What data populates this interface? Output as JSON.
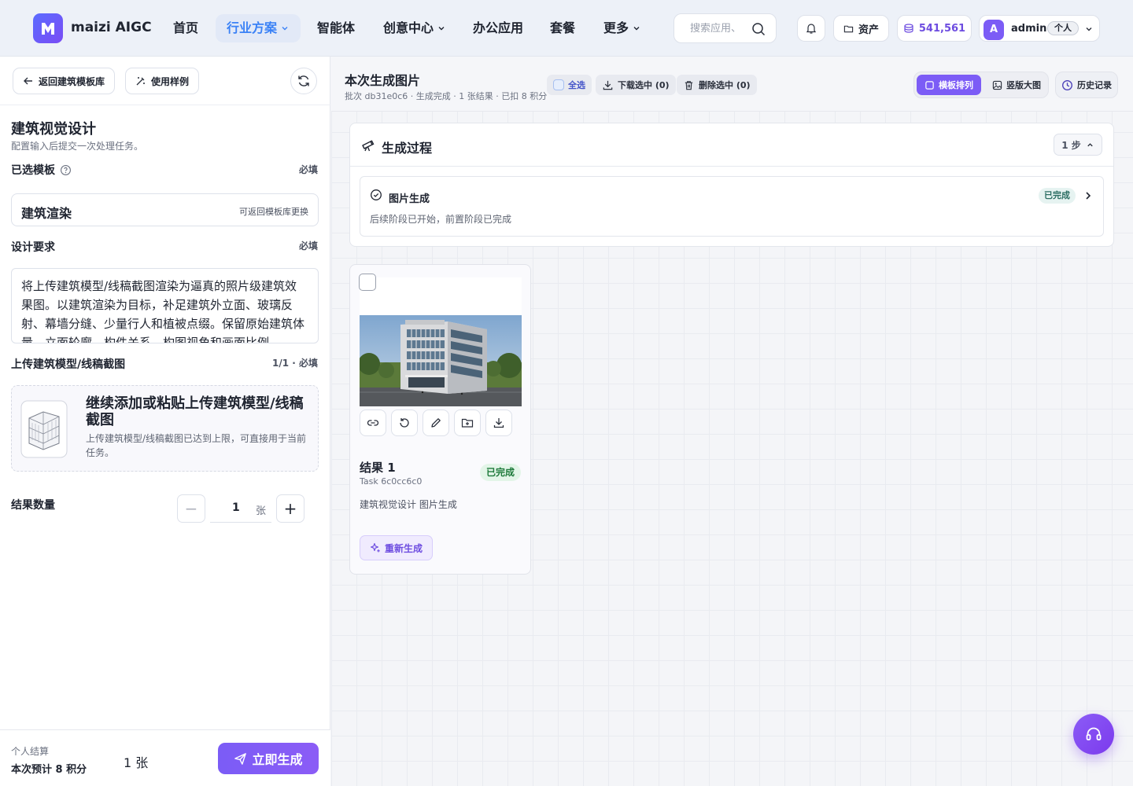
{
  "header": {
    "brand": "maizi AIGC",
    "nav": [
      "首页",
      "行业方案",
      "智能体",
      "创意中心",
      "办公应用",
      "套餐",
      "更多"
    ],
    "search_placeholder": "搜索应用、",
    "assets_label": "资产",
    "points": "541,561",
    "user": {
      "initial": "A",
      "name": "admin",
      "tag": "个人"
    }
  },
  "left": {
    "back_button": "返回建筑模板库",
    "examples_button": "使用样例",
    "title": "建筑视觉设计",
    "subtitle": "配置输入后提交一次处理任务。",
    "template_label": "已选模板",
    "required": "必填",
    "template_name": "建筑渲染",
    "template_hint": "可返回模板库更换",
    "design_label": "设计要求",
    "design_text": "将上传建筑模型/线稿截图渲染为逼真的照片级建筑效果图。以建筑渲染为目标，补足建筑外立面、玻璃反射、幕墙分缝、少量行人和植被点缀。保留原始建筑体量、立面轮廓、构件关系、构图视角和画面比例。",
    "upload_label": "上传建筑模型/线稿截图",
    "upload_required": "1/1 · 必填",
    "upload_title": "继续添加或粘贴上传建筑模型/线稿截图",
    "upload_desc": "上传建筑模型/线稿截图已达到上限，可直接用于当前任务。",
    "count_label": "结果数量",
    "count_value": "1",
    "count_unit": "张",
    "footer_line1": "个人结算",
    "footer_line2": "本次预计 8 积分",
    "footer_count": "1 张",
    "generate_button": "立即生成"
  },
  "right": {
    "title": "本次生成图片",
    "meta": "批次 db31e0c6 · 生成完成 · 1 张结果 · 已扣 8 积分",
    "select_all": "全选",
    "download_selected": "下载选中 (0)",
    "delete_selected": "删除选中 (0)",
    "view_grid": "横板排列",
    "view_large": "竖版大图",
    "history": "历史记录",
    "process_title": "生成过程",
    "process_steps": "1 步",
    "stage_title": "图片生成",
    "stage_status": "已完成",
    "stage_desc": "后续阶段已开始，前置阶段已完成",
    "result": {
      "title": "结果 1",
      "task": "Task 6c0cc6c0",
      "status": "已完成",
      "desc": "建筑视觉设计 图片生成",
      "regenerate": "重新生成"
    }
  },
  "colors": {
    "accent": "#7c5cf6",
    "active_nav": "#3b82f6",
    "success": "#1e7a3b"
  }
}
